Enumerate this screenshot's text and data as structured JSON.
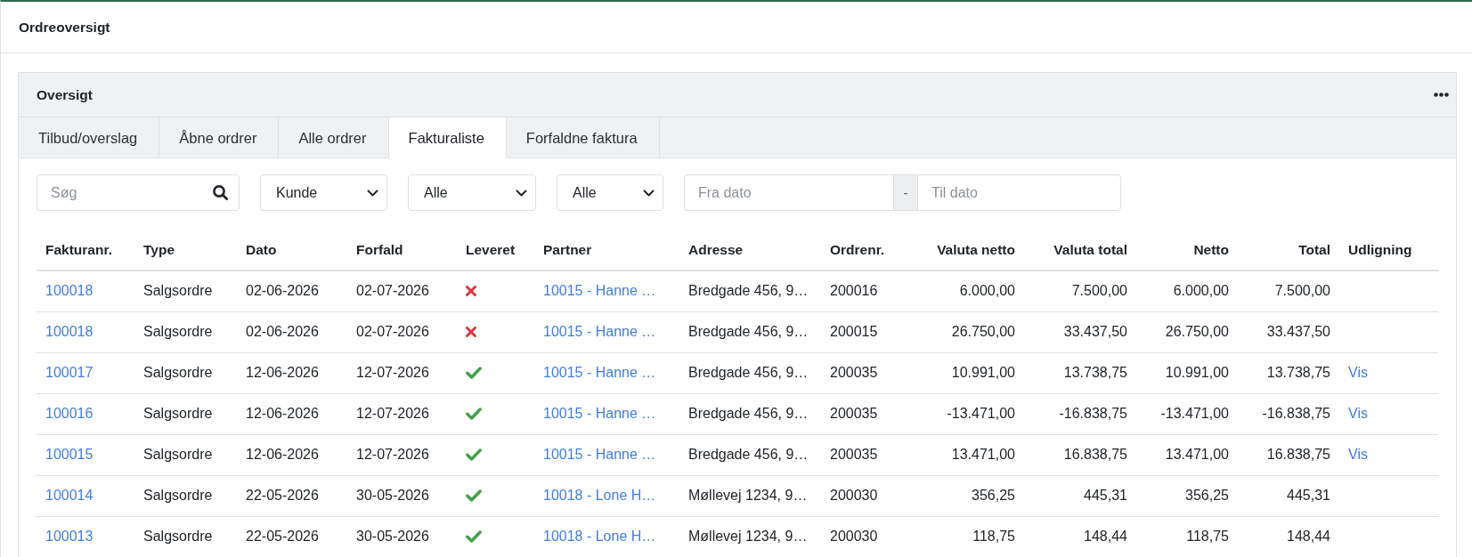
{
  "page": {
    "title": "Ordreoversigt"
  },
  "card": {
    "title": "Oversigt"
  },
  "tabs": [
    {
      "label": "Tilbud/overslag",
      "selected": false
    },
    {
      "label": "Åbne ordrer",
      "selected": false
    },
    {
      "label": "Alle ordrer",
      "selected": false
    },
    {
      "label": "Fakturaliste",
      "selected": true
    },
    {
      "label": "Forfaldne faktura",
      "selected": false
    }
  ],
  "filters": {
    "search": {
      "placeholder": "Søg"
    },
    "selects": [
      {
        "value": "Kunde"
      },
      {
        "value": "Alle"
      },
      {
        "value": "Alle"
      }
    ],
    "date_range": {
      "from": {
        "placeholder": "Fra dato"
      },
      "separator": "-",
      "to": {
        "placeholder": "Til dato"
      }
    }
  },
  "table": {
    "columns": [
      {
        "label": "Fakturanr.",
        "kind": "link"
      },
      {
        "label": "Type",
        "kind": "text"
      },
      {
        "label": "Dato",
        "kind": "text"
      },
      {
        "label": "Forfald",
        "kind": "text"
      },
      {
        "label": "Leveret",
        "kind": "status"
      },
      {
        "label": "Partner",
        "kind": "link"
      },
      {
        "label": "Adresse",
        "kind": "text"
      },
      {
        "label": "Ordrenr.",
        "kind": "text"
      },
      {
        "label": "Valuta netto",
        "kind": "number"
      },
      {
        "label": "Valuta total",
        "kind": "number"
      },
      {
        "label": "Netto",
        "kind": "number"
      },
      {
        "label": "Total",
        "kind": "number"
      },
      {
        "label": "Udligning",
        "kind": "link"
      }
    ],
    "rows": [
      {
        "invoice": "100018",
        "type": "Salgsordre",
        "date": "02-06-2026",
        "due": "02-07-2026",
        "delivered": false,
        "partner": "10015 - Hanne …",
        "address": "Bredgade 456, 9…",
        "order": "200016",
        "currency_net": "6.000,00",
        "currency_total": "7.500,00",
        "net": "6.000,00",
        "total": "7.500,00"
      },
      {
        "invoice": "100018",
        "type": "Salgsordre",
        "date": "02-06-2026",
        "due": "02-07-2026",
        "delivered": false,
        "partner": "10015 - Hanne …",
        "address": "Bredgade 456, 9…",
        "order": "200015",
        "currency_net": "26.750,00",
        "currency_total": "33.437,50",
        "net": "26.750,00",
        "total": "33.437,50"
      },
      {
        "invoice": "100017",
        "type": "Salgsordre",
        "date": "12-06-2026",
        "due": "12-07-2026",
        "delivered": true,
        "partner": "10015 - Hanne …",
        "address": "Bredgade 456, 9…",
        "order": "200035",
        "currency_net": "10.991,00",
        "currency_total": "13.738,75",
        "net": "10.991,00",
        "total": "13.738,75",
        "settlement": "Vis"
      },
      {
        "invoice": "100016",
        "type": "Salgsordre",
        "date": "12-06-2026",
        "due": "12-07-2026",
        "delivered": true,
        "partner": "10015 - Hanne …",
        "address": "Bredgade 456, 9…",
        "order": "200035",
        "currency_net": "-13.471,00",
        "currency_total": "-16.838,75",
        "net": "-13.471,00",
        "total": "-16.838,75",
        "settlement": "Vis"
      },
      {
        "invoice": "100015",
        "type": "Salgsordre",
        "date": "12-06-2026",
        "due": "12-07-2026",
        "delivered": true,
        "partner": "10015 - Hanne …",
        "address": "Bredgade 456, 9…",
        "order": "200035",
        "currency_net": "13.471,00",
        "currency_total": "16.838,75",
        "net": "13.471,00",
        "total": "16.838,75",
        "settlement": "Vis"
      },
      {
        "invoice": "100014",
        "type": "Salgsordre",
        "date": "22-05-2026",
        "due": "30-05-2026",
        "delivered": true,
        "partner": "10018 - Lone H…",
        "address": "Møllevej 1234, 9…",
        "order": "200030",
        "currency_net": "356,25",
        "currency_total": "445,31",
        "net": "356,25",
        "total": "445,31"
      },
      {
        "invoice": "100013",
        "type": "Salgsordre",
        "date": "22-05-2026",
        "due": "30-05-2026",
        "delivered": true,
        "partner": "10018 - Lone H…",
        "address": "Møllevej 1234, 9…",
        "order": "200030",
        "currency_net": "118,75",
        "currency_total": "148,44",
        "net": "118,75",
        "total": "148,44"
      }
    ]
  }
}
